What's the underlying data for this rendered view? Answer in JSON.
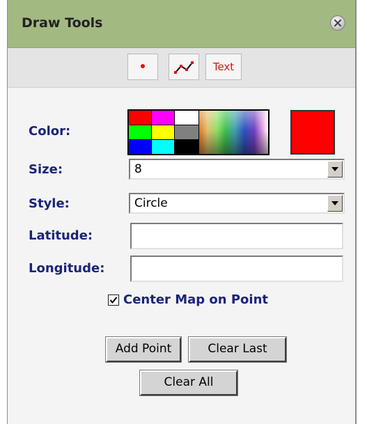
{
  "panel": {
    "title": "Draw Tools"
  },
  "toolbar": {
    "tools": [
      {
        "name": "point-tool",
        "icon": "red-dot-icon"
      },
      {
        "name": "line-tool",
        "icon": "polyline-icon"
      },
      {
        "name": "text-tool",
        "label": "Text"
      }
    ]
  },
  "form": {
    "color_label": "Color:",
    "selected_color": "#ff0000",
    "size_label": "Size:",
    "size_value": "8",
    "style_label": "Style:",
    "style_value": "Circle",
    "latitude_label": "Latitude:",
    "latitude_value": "",
    "longitude_label": "Longitude:",
    "longitude_value": "",
    "center_map_label": "Center Map on Point",
    "center_map_checked": true
  },
  "buttons": {
    "add_point": "Add Point",
    "clear_last": "Clear Last",
    "clear_all": "Clear All"
  },
  "palette": {
    "colors": [
      "#ff0000",
      "#ff00ff",
      "#00ff00",
      "#ffff00",
      "#0000ff",
      "#00ffff",
      "#ffffff",
      "#808080",
      "#000000"
    ]
  }
}
